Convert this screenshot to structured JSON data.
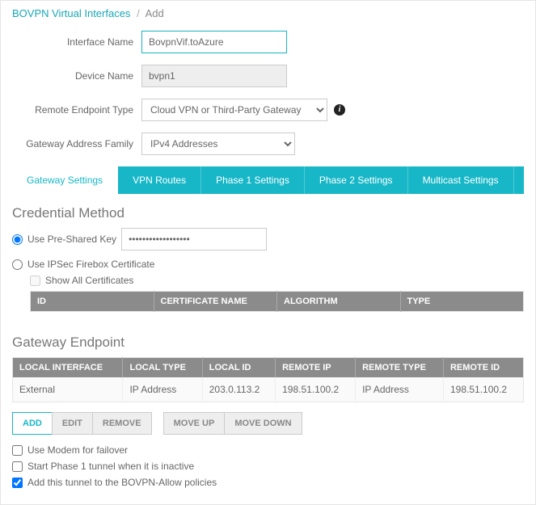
{
  "breadcrumb": {
    "parent": "BOVPN Virtual Interfaces",
    "current": "Add"
  },
  "form": {
    "interface_name": {
      "label": "Interface Name",
      "value": "BovpnVif.toAzure"
    },
    "device_name": {
      "label": "Device Name",
      "value": "bvpn1"
    },
    "remote_endpoint_type": {
      "label": "Remote Endpoint Type",
      "value": "Cloud VPN or Third-Party Gateway"
    },
    "gateway_address_family": {
      "label": "Gateway Address Family",
      "value": "IPv4 Addresses"
    }
  },
  "tabs": [
    "Gateway Settings",
    "VPN Routes",
    "Phase 1 Settings",
    "Phase 2 Settings",
    "Multicast Settings"
  ],
  "credential": {
    "heading": "Credential Method",
    "psk_label": "Use Pre-Shared Key",
    "psk_value": "••••••••••••••••••",
    "cert_label": "Use IPSec Firebox Certificate",
    "show_all_label": "Show All Certificates",
    "cert_headers": [
      "ID",
      "CERTIFICATE NAME",
      "ALGORITHM",
      "TYPE"
    ]
  },
  "endpoint": {
    "heading": "Gateway Endpoint",
    "headers": [
      "LOCAL INTERFACE",
      "LOCAL TYPE",
      "LOCAL ID",
      "REMOTE IP",
      "REMOTE TYPE",
      "REMOTE ID"
    ],
    "rows": [
      {
        "local_interface": "External",
        "local_type": "IP Address",
        "local_id": "203.0.113.2",
        "remote_ip": "198.51.100.2",
        "remote_type": "IP Address",
        "remote_id": "198.51.100.2"
      }
    ]
  },
  "buttons": {
    "add": "ADD",
    "edit": "EDIT",
    "remove": "REMOVE",
    "moveup": "MOVE UP",
    "movedown": "MOVE DOWN"
  },
  "options": {
    "modem": "Use Modem for failover",
    "phase1": "Start Phase 1 tunnel when it is inactive",
    "bovpn_allow": "Add this tunnel to the BOVPN-Allow policies"
  }
}
